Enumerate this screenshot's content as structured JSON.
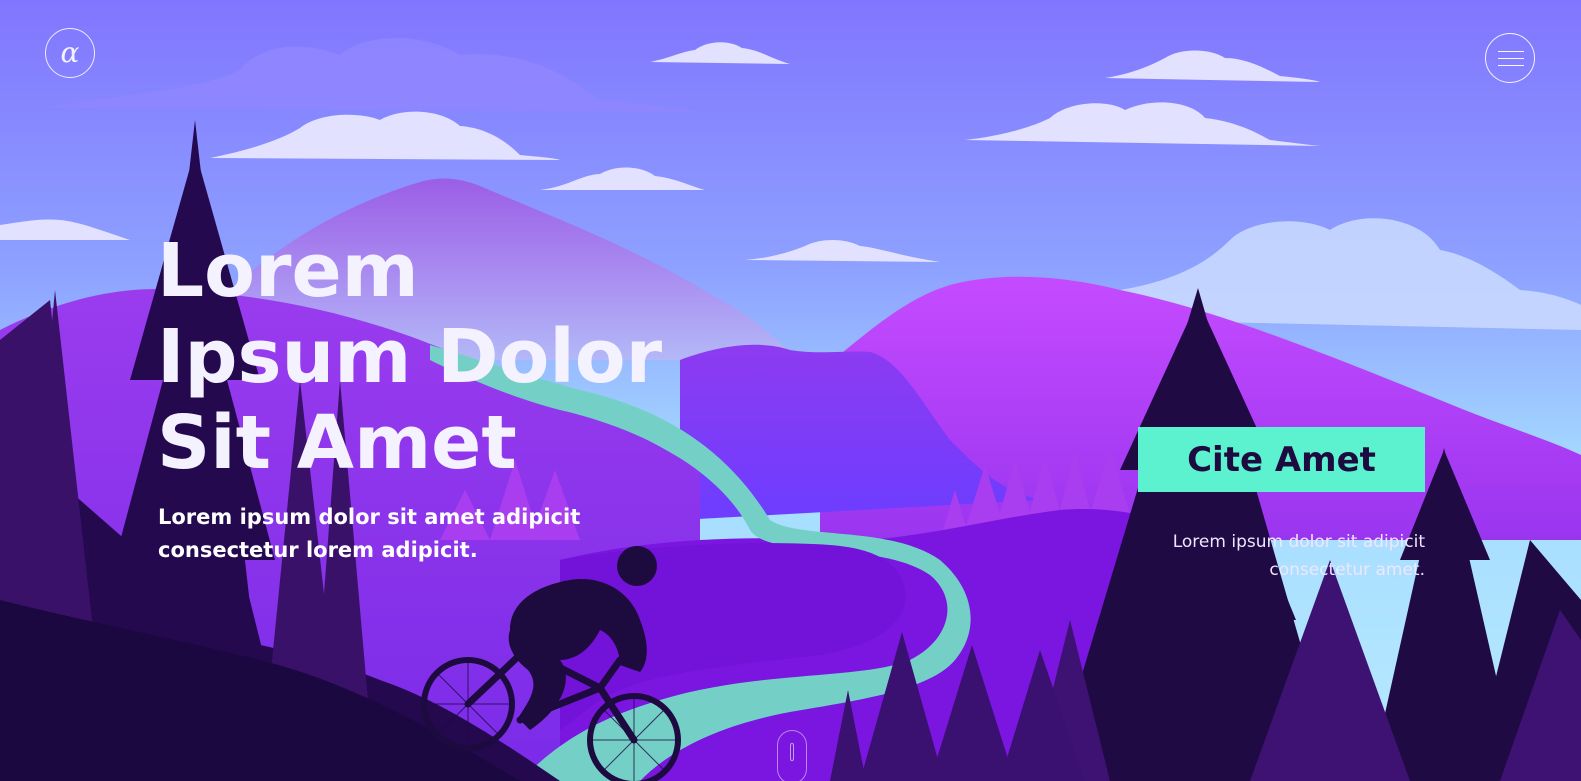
{
  "header": {
    "logo_glyph": "α",
    "logo_icon": "alpha-logo-icon",
    "menu_icon": "hamburger-menu-icon"
  },
  "hero": {
    "headline_lines": [
      "Lorem",
      "Ipsum Dolor",
      "Sit Amet"
    ],
    "subtitle": "Lorem ipsum dolor sit amet adipicit consectetur lorem adipicit.",
    "cta_label": "Cite Amet",
    "side_text": "Lorem ipsum dolor sit adipicit consectetur amet."
  },
  "scroll": {
    "icon": "mouse-scroll-icon"
  },
  "colors": {
    "sky_top": "#8578ff",
    "sky_bottom": "#a6e3ff",
    "cta_bg": "#5df2cf",
    "cta_text": "#1d0a3f",
    "trail": "#72d3c6",
    "tree_dark": "#1f0a42"
  }
}
